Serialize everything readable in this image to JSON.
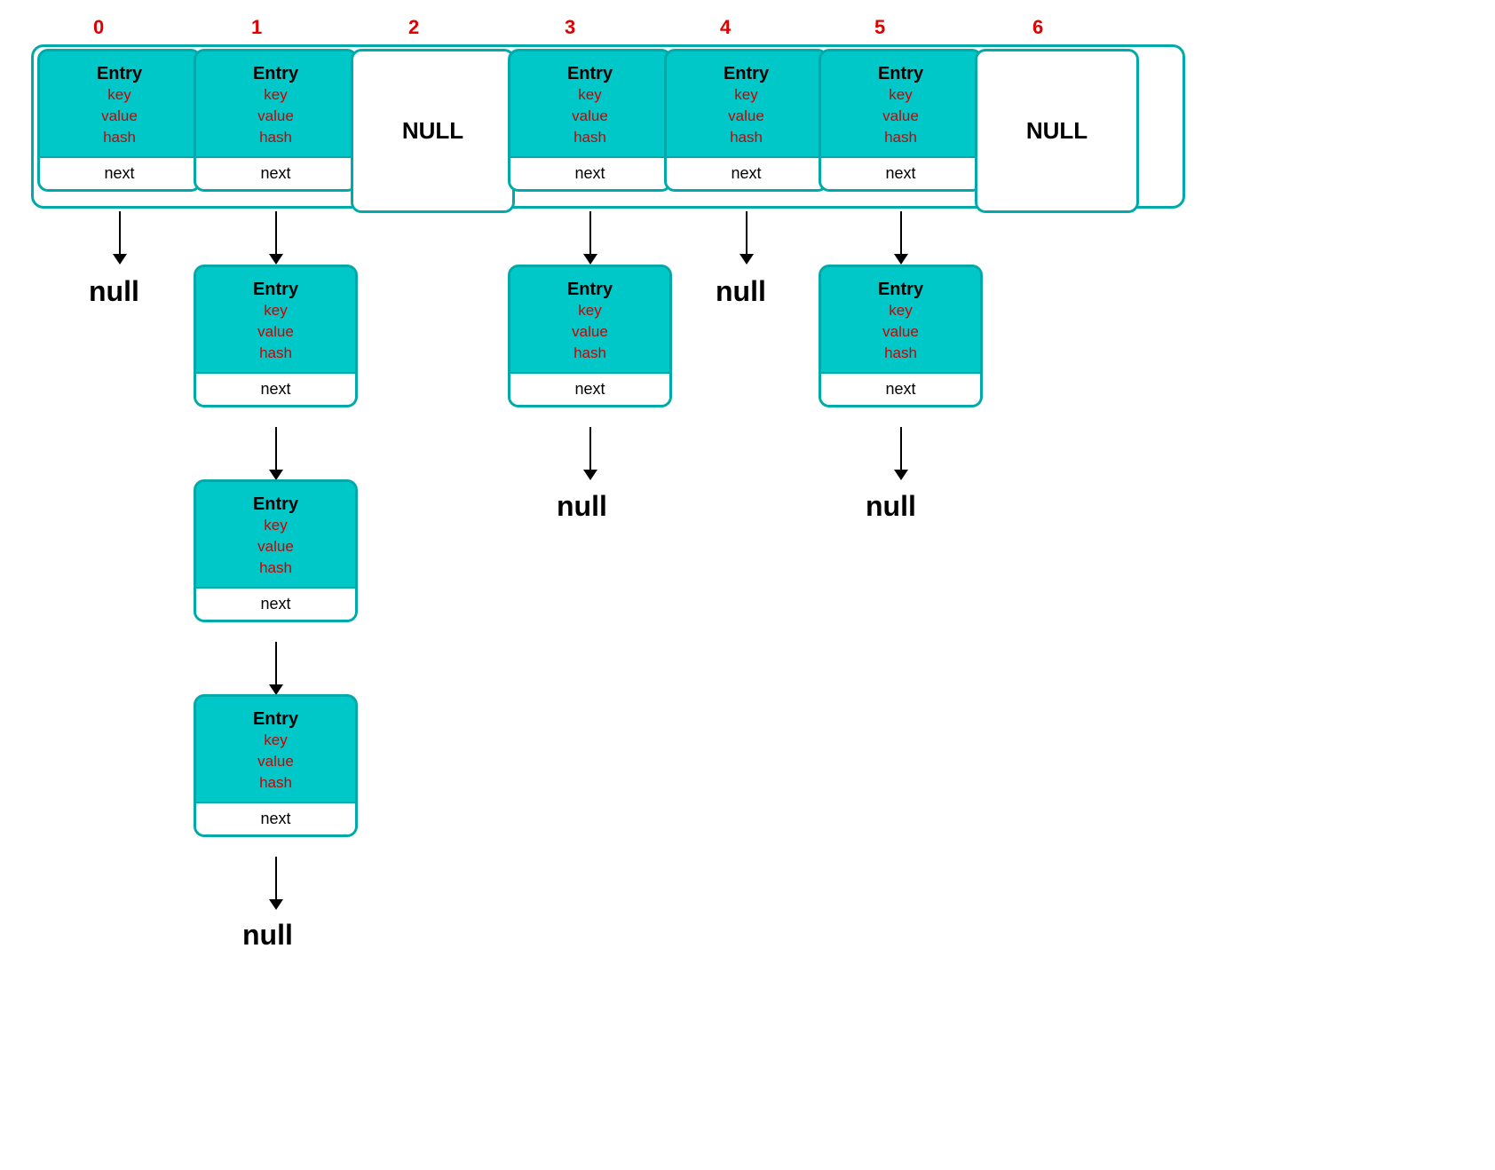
{
  "indices": [
    "0",
    "1",
    "2",
    "3",
    "4",
    "5",
    "6"
  ],
  "index_positions": [
    105,
    280,
    455,
    630,
    800,
    975,
    1155
  ],
  "colors": {
    "teal": "#00c8c8",
    "red_label": "#e00000",
    "red_field": "#cc0000",
    "border": "#00aaaa"
  },
  "entry_label": "Entry",
  "fields": [
    "key",
    "value",
    "hash"
  ],
  "next_label": "next",
  "null_label": "null",
  "null_box_label": "NULL",
  "array": {
    "cells": [
      {
        "type": "entry",
        "index": 0
      },
      {
        "type": "entry",
        "index": 1
      },
      {
        "type": "null_box",
        "index": 2
      },
      {
        "type": "entry",
        "index": 3
      },
      {
        "type": "entry",
        "index": 4
      },
      {
        "type": "entry",
        "index": 5
      },
      {
        "type": "null_box",
        "index": 6
      }
    ]
  }
}
